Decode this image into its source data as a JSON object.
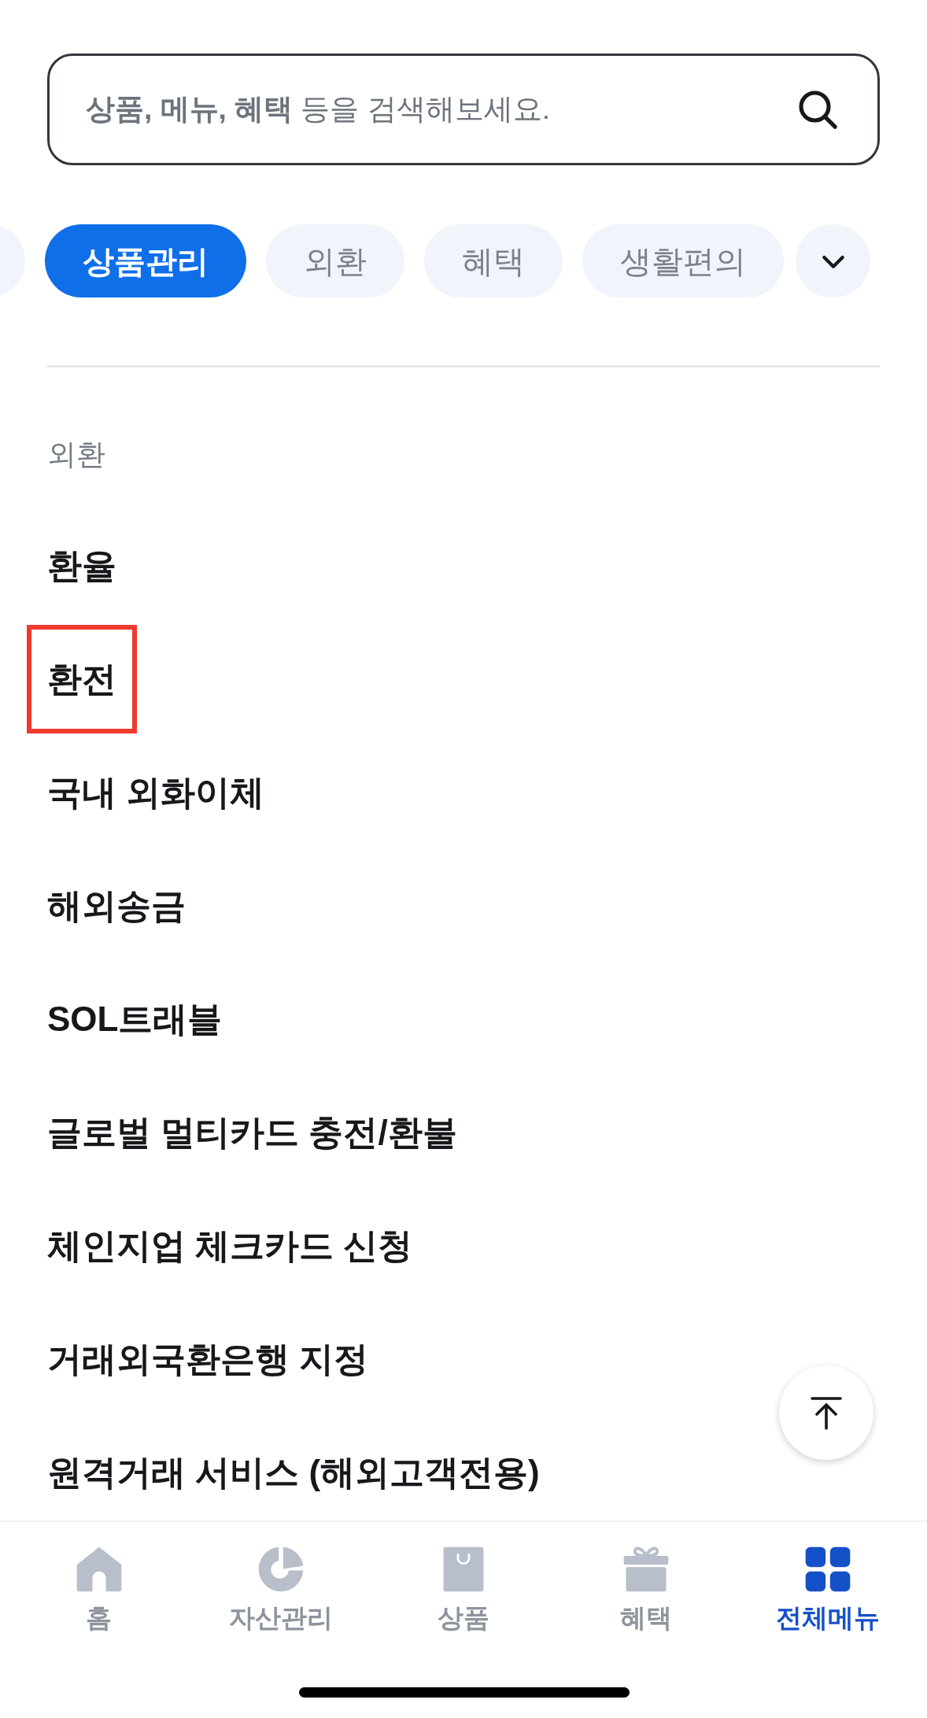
{
  "search": {
    "placeholder": "**상품, 메뉴, 혜택** 등을 검색해보세요."
  },
  "tabs": [
    {
      "label": "상품관리",
      "selected": true
    },
    {
      "label": "외환",
      "selected": false
    },
    {
      "label": "혜택",
      "selected": false
    },
    {
      "label": "생활편의",
      "selected": false
    }
  ],
  "section": {
    "title": "외환",
    "items": [
      {
        "label": "환율",
        "highlighted": false
      },
      {
        "label": "환전",
        "highlighted": true
      },
      {
        "label": "국내 외화이체",
        "highlighted": false
      },
      {
        "label": "해외송금",
        "highlighted": false
      },
      {
        "label": "SOL트래블",
        "highlighted": false
      },
      {
        "label": "글로벌 멀티카드 충전/환불",
        "highlighted": false
      },
      {
        "label": "체인지업 체크카드 신청",
        "highlighted": false
      },
      {
        "label": "거래외국환은행 지정",
        "highlighted": false
      },
      {
        "label": "원격거래 서비스 (해외고객전용)",
        "highlighted": false
      }
    ]
  },
  "bottom_nav": [
    {
      "label": "홈",
      "kind": "home",
      "selected": false
    },
    {
      "label": "자산관리",
      "kind": "assets",
      "selected": false
    },
    {
      "label": "상품",
      "kind": "products",
      "selected": false
    },
    {
      "label": "혜택",
      "kind": "benefits",
      "selected": false
    },
    {
      "label": "전체메뉴",
      "kind": "all",
      "selected": true
    }
  ]
}
